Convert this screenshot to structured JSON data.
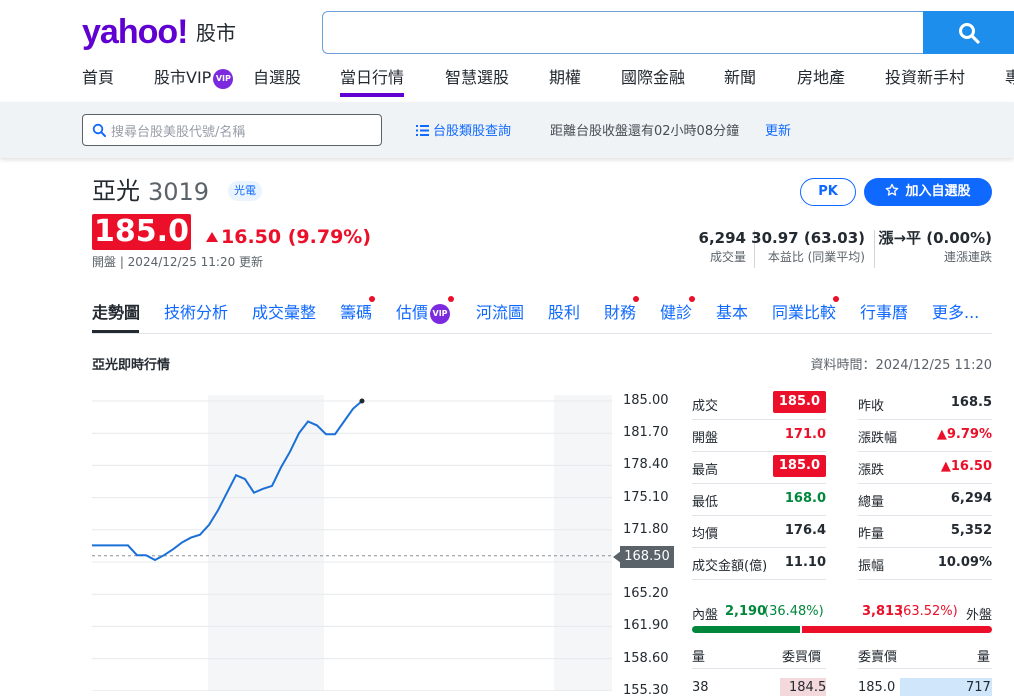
{
  "header": {
    "logo": "yahoo!",
    "logo_sub": "股市",
    "search_value": "",
    "main_nav": [
      "首頁",
      "股市VIP",
      "自選股",
      "當日行情",
      "智慧選股",
      "期權",
      "國際金融",
      "新聞",
      "房地產",
      "投資新手村",
      "專"
    ],
    "vip_label": "VIP",
    "active_nav": "當日行情"
  },
  "subbar": {
    "search_placeholder": "搜尋台股美股代號/名稱",
    "category_link": "台股類股查詢",
    "countdown_text": "距離台股收盤還有02小時08分鐘",
    "refresh_link": "更新"
  },
  "quote": {
    "name": "亞光",
    "code": "3019",
    "tag": "光電",
    "pk_label": "PK",
    "add_label": "加入自選股",
    "price": "185.0",
    "change": "16.50",
    "change_pct": "(9.79%)",
    "meta": "開盤 | 2024/12/25 11:20 更新",
    "stats": [
      {
        "value": "6,294",
        "label": "成交量"
      },
      {
        "value": "30.97 (63.03)",
        "label": "本益比 (同業平均)"
      },
      {
        "value": "漲→平 (0.00%)",
        "label": "連漲連跌"
      }
    ]
  },
  "tabs": [
    "走勢圖",
    "技術分析",
    "成交彙整",
    "籌碼",
    "估價",
    "河流圖",
    "股利",
    "財務",
    "健診",
    "基本",
    "同業比較",
    "行事曆",
    "更多..."
  ],
  "section": {
    "title": "亞光即時行情",
    "time": "資料時間：2024/12/25 11:20"
  },
  "chart_data": {
    "type": "line",
    "y_ticks": [
      "185.00",
      "181.70",
      "178.40",
      "175.10",
      "171.80",
      "168.50",
      "165.20",
      "161.90",
      "158.60",
      "155.30"
    ],
    "ylim": [
      155.3,
      185.0
    ],
    "reference": "168.50",
    "x_session_fraction": [
      0,
      0.02,
      0.04,
      0.06,
      0.075,
      0.09,
      0.105,
      0.12,
      0.135,
      0.15,
      0.165,
      0.18,
      0.195,
      0.21,
      0.225,
      0.24,
      0.255,
      0.27,
      0.285,
      0.3,
      0.315,
      0.33,
      0.345,
      0.36,
      0.375,
      0.39,
      0.405,
      0.42,
      0.435,
      0.45
    ],
    "values": [
      170.2,
      170.2,
      170.2,
      170.2,
      169.2,
      169.2,
      168.7,
      169.2,
      169.8,
      170.5,
      171.0,
      171.3,
      172.3,
      173.8,
      175.6,
      177.4,
      177.0,
      175.6,
      176.0,
      176.3,
      178.2,
      179.8,
      181.7,
      182.9,
      182.5,
      181.6,
      181.6,
      182.9,
      184.2,
      185.0
    ]
  },
  "details": {
    "left": [
      {
        "k": "成交",
        "v": "185.0",
        "style": "boxed"
      },
      {
        "k": "開盤",
        "v": "171.0",
        "style": "up"
      },
      {
        "k": "最高",
        "v": "185.0",
        "style": "boxed"
      },
      {
        "k": "最低",
        "v": "168.0",
        "style": "down"
      },
      {
        "k": "均價",
        "v": "176.4",
        "style": "neutral"
      },
      {
        "k": "成交金額(億)",
        "v": "11.10",
        "style": "neutral"
      }
    ],
    "right": [
      {
        "k": "昨收",
        "v": "168.5",
        "style": "neutral"
      },
      {
        "k": "漲跌幅",
        "v": "▲9.79%",
        "style": "up"
      },
      {
        "k": "漲跌",
        "v": "▲16.50",
        "style": "up"
      },
      {
        "k": "總量",
        "v": "6,294",
        "style": "neutral"
      },
      {
        "k": "昨量",
        "v": "5,352",
        "style": "neutral"
      },
      {
        "k": "振幅",
        "v": "10.09%",
        "style": "neutral"
      }
    ]
  },
  "orderbook": {
    "inner_label": "內盤",
    "inner_value": "2,190",
    "inner_pct": "(36.48%)",
    "outer_value": "3,813",
    "outer_pct": "(63.52%)",
    "outer_label": "外盤",
    "inner_fraction": 0.3648,
    "headers": [
      "量",
      "委買價",
      "委賣價",
      "量"
    ],
    "row1": [
      "38",
      "184.5",
      "185.0",
      "717"
    ]
  },
  "colors": {
    "up": "#eb0f29",
    "down": "#00873c",
    "accent": "#0f69ff",
    "brand": "#6001d2"
  }
}
